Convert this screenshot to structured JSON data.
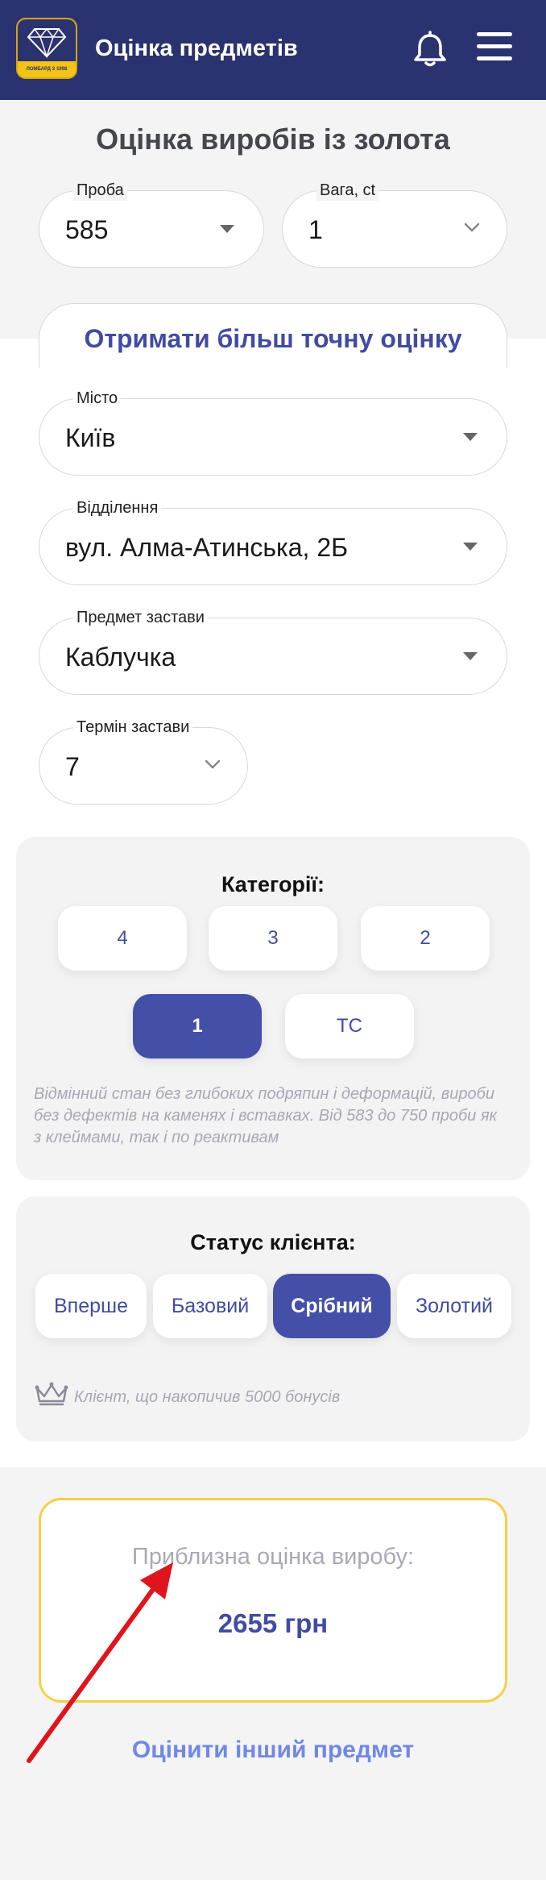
{
  "header": {
    "title": "Оцінка предметів",
    "logo_text": "ЛОМБАРД З 1998",
    "icons": {
      "logo": "diamond-logo",
      "notifications": "bell-icon",
      "menu": "hamburger-menu-icon"
    },
    "bg_color": "#2b3270"
  },
  "page_title": "Оцінка виробів із золота",
  "fields": {
    "proba": {
      "label": "Проба",
      "value": "585"
    },
    "weight": {
      "label": "Вага, ct",
      "value": "1"
    },
    "city": {
      "label": "Місто",
      "value": "Київ"
    },
    "branch": {
      "label": "Відділення",
      "value": "вул. Алма-Атинська, 2Б"
    },
    "item": {
      "label": "Предмет застави",
      "value": "Каблучка"
    },
    "term": {
      "label": "Термін застави",
      "value": "7"
    }
  },
  "precise_tab": {
    "label": "Отримати більш точну оцінку"
  },
  "categories": {
    "title": "Категорії:",
    "items": [
      "4",
      "3",
      "2",
      "1",
      "ТС"
    ],
    "selected": "1",
    "description": "Відмінний стан без глибоких подряпин і деформацій, вироби без дефектів на каменях і вставках. Від 583 до 750 проби як з клеймами, так і по реактивам"
  },
  "client_status": {
    "title": "Статус клієнта:",
    "items": [
      "Вперше",
      "Базовий",
      "Срібний",
      "Золотий"
    ],
    "selected": "Срібний",
    "note": "Клієнт, що накопичив 5000 бонусів",
    "note_icon": "crown-icon"
  },
  "estimate": {
    "label": "Приблизна оцінка виробу:",
    "value": "2655 грн",
    "border_color": "#f5cf45"
  },
  "another_item": "Оцінити інший предмет",
  "colors": {
    "accent": "#414ba4",
    "accent_fill": "#4450a8",
    "link": "#6f88e8",
    "annotation_arrow": "#e0141e"
  }
}
